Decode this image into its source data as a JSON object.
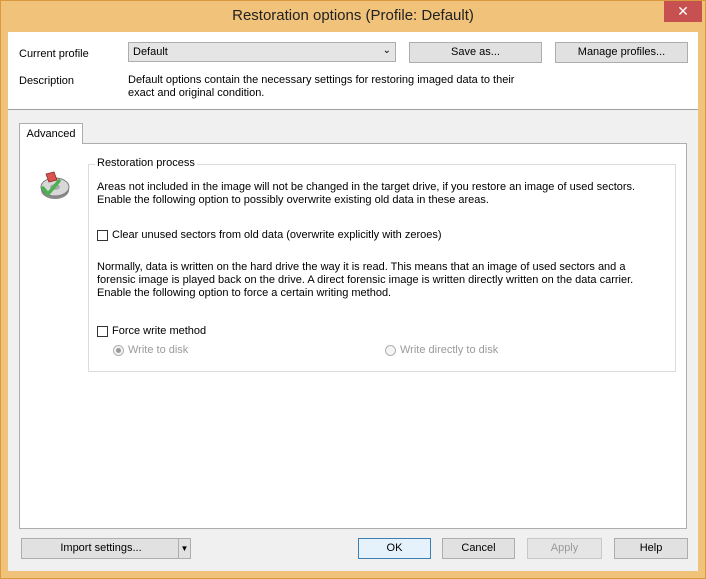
{
  "window": {
    "title": "Restoration options (Profile: Default)",
    "close_label": "✕"
  },
  "header": {
    "current_profile_label": "Current profile",
    "profile_value": "Default",
    "save_as_label": "Save as...",
    "manage_profiles_label": "Manage profiles...",
    "description_label": "Description",
    "description_text": "Default options contain the necessary settings for restoring imaged data to their exact and original condition."
  },
  "tabs": [
    {
      "label": "Advanced",
      "selected": true
    }
  ],
  "restoration": {
    "group_title": "Restoration process",
    "para1": "Areas not included in the image will not be changed in the target drive, if you restore an image of used sectors. Enable the following option to possibly overwrite existing old data in these areas.",
    "clear_unused_label": "Clear unused sectors from old data (overwrite explicitly with zeroes)",
    "clear_unused_checked": false,
    "para2": "Normally, data is written on the hard drive the way it is read. This means that an image of used sectors and a forensic image is played back on the drive. A direct forensic image is written directly written on the data carrier. Enable the following option to force a certain writing method.",
    "force_write_label": "Force write method",
    "force_write_checked": false,
    "write_to_disk_label": "Write to disk",
    "write_directly_label": "Write directly to disk"
  },
  "footer": {
    "import_label": "Import settings...",
    "ok_label": "OK",
    "cancel_label": "Cancel",
    "apply_label": "Apply",
    "help_label": "Help"
  }
}
